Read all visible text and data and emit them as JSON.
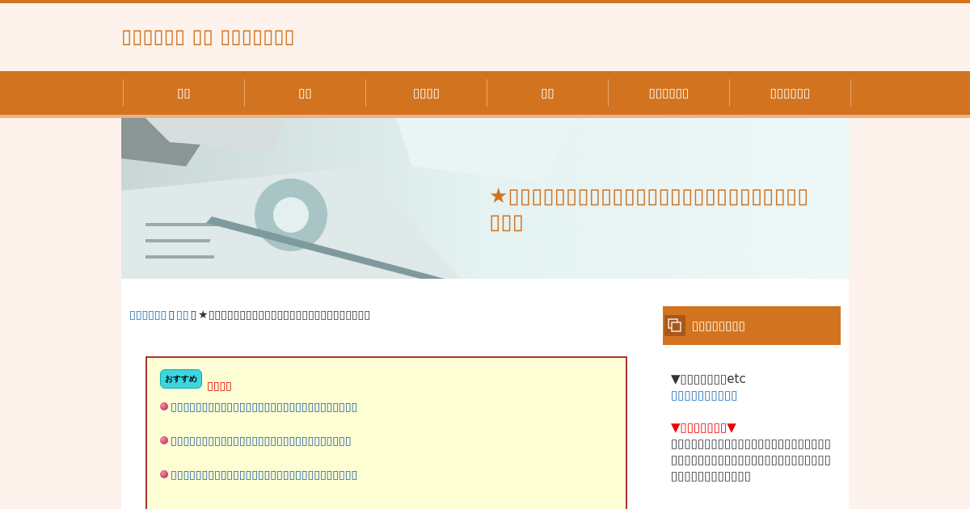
{
  "site_title": "▯▯▯▯▯▯ ▯▯ ▯▯▯▯▯▯▯",
  "nav": [
    {
      "label": "▯▯"
    },
    {
      "label": "▯▯"
    },
    {
      "label": "▯▯▯▯"
    },
    {
      "label": "▯▯"
    },
    {
      "label": "▯▯▯▯▯▯"
    },
    {
      "label": "▯▯▯▯▯▯"
    }
  ],
  "banner": {
    "kind": "picture",
    "headline": "★▯▯▯▯▯▯▯▯▯▯▯▯▯▯▯▯▯▯▯▯▯▯▯▯▯▯▯▯▯"
  },
  "breadcrumb": [
    {
      "kind": "link",
      "text": "▯▯▯▯▯▯"
    },
    {
      "kind": "text",
      "text": "▯"
    },
    {
      "kind": "link",
      "text": "▯▯"
    },
    {
      "kind": "text",
      "text": "▯"
    },
    {
      "kind": "text",
      "text": "★▯▯▯▯▯▯▯▯▯▯▯▯▯▯▯▯▯▯▯▯▯▯▯▯▯▯"
    }
  ],
  "recommend": {
    "badge": "おすすめ",
    "heading": "▯▯▯▯",
    "links": [
      "▯▯▯▯▯▯▯▯▯▯▯▯▯▯▯▯▯▯▯▯▯▯▯▯▯▯▯▯▯▯",
      "▯▯▯▯▯▯▯▯▯▯▯▯▯▯▯▯▯▯▯▯▯▯▯▯▯▯▯▯▯",
      "▯▯▯▯▯▯▯▯▯▯▯▯▯▯▯▯▯▯▯▯▯▯▯▯▯▯▯▯▯▯"
    ]
  },
  "sidebar": {
    "title": "▯▯▯▯▯▯▯▯",
    "items": [
      {
        "kind": "text",
        "text": "▼▯▯▯▯▯▯▯etc"
      },
      {
        "kind": "link",
        "text": "▯▯▯▯▯▯▯▯▯▯"
      },
      {
        "kind": "gap"
      },
      {
        "kind": "alert",
        "text": "▼▯▯▯▯▯▯▯▼"
      },
      {
        "kind": "text",
        "text": "▯▯▯▯▯▯▯▯▯▯▯▯▯▯▯▯▯▯▯▯▯▯▯▯▯▯▯▯▯▯▯▯▯▯▯▯▯▯▯▯▯▯▯▯▯▯▯▯"
      },
      {
        "kind": "text",
        "text": "▯▯▯▯▯▯▯▯▯▯▯▯"
      }
    ]
  }
}
